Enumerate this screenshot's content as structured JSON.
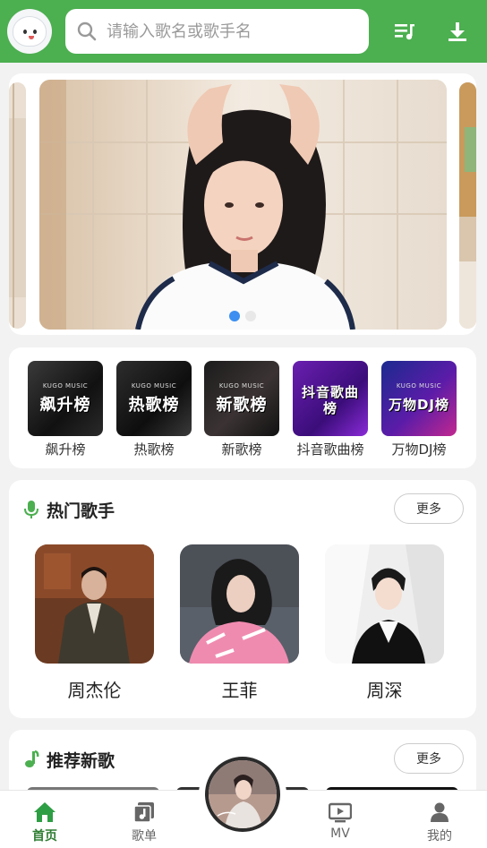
{
  "header": {
    "search_placeholder": "请输入歌名或歌手名",
    "icons": [
      "search-icon",
      "playlist-icon",
      "download-icon"
    ],
    "accent_color": "#4caf50"
  },
  "banner": {
    "slide_count": 2,
    "active_slide": 1
  },
  "charts": {
    "items": [
      {
        "label": "飙升榜",
        "cover_title": "飙升榜",
        "brand": "KUGO MUSIC"
      },
      {
        "label": "热歌榜",
        "cover_title": "热歌榜",
        "brand": "KUGO MUSIC"
      },
      {
        "label": "新歌榜",
        "cover_title": "新歌榜",
        "brand": "KUGO MUSIC"
      },
      {
        "label": "抖音歌曲榜",
        "cover_title": "抖音歌曲榜",
        "brand": ""
      },
      {
        "label": "万物DJ榜",
        "cover_title": "万物DJ榜",
        "brand": "KUGO MUSIC"
      }
    ]
  },
  "hot_singers": {
    "title": "热门歌手",
    "more_label": "更多",
    "singers": [
      "周杰伦",
      "王菲",
      "周深"
    ]
  },
  "new_songs": {
    "title": "推荐新歌",
    "more_label": "更多"
  },
  "tabbar": {
    "tabs": [
      {
        "label": "首页",
        "icon": "home-icon",
        "active": true
      },
      {
        "label": "歌单",
        "icon": "playlist-album-icon",
        "active": false
      },
      {
        "label": "MV",
        "icon": "tv-icon",
        "active": false
      },
      {
        "label": "我的",
        "icon": "person-icon",
        "active": false
      }
    ]
  }
}
